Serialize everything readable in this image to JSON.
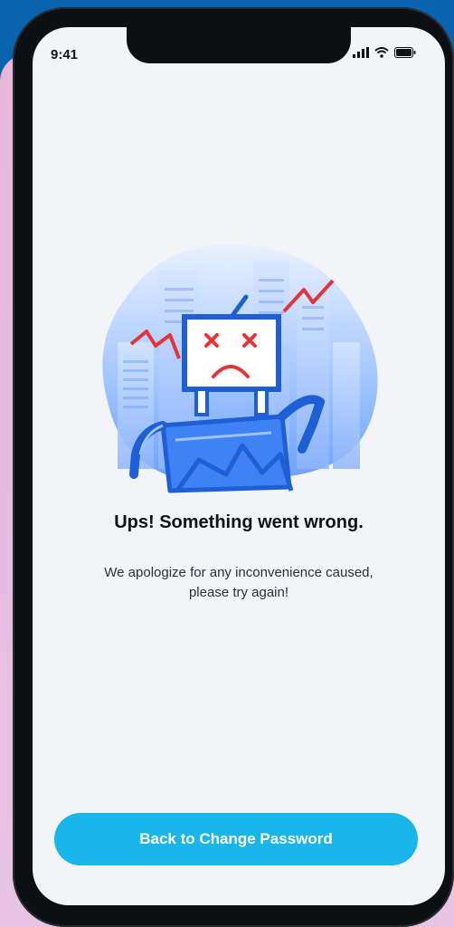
{
  "status_bar": {
    "time": "9:41",
    "icons": [
      "cellular-signal-icon",
      "wifi-icon",
      "battery-icon"
    ]
  },
  "illustration": {
    "name": "broken-robot-illustration"
  },
  "message": {
    "title": "Ups! Something went wrong.",
    "description": "We apologize for any inconvenience caused, please try again!"
  },
  "actions": {
    "primary_button_label": "Back to Change Password"
  },
  "colors": {
    "primary": "#19b6ea",
    "illustration_blue": "#3f82f5",
    "error_red": "#e5333a",
    "background": "#f3f4f8"
  }
}
